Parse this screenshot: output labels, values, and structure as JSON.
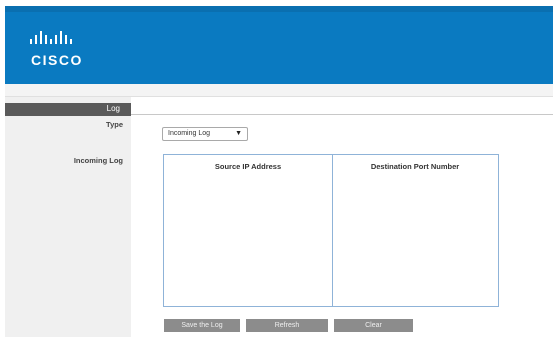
{
  "brand": {
    "logo_word": "CISCO",
    "accent_color": "#0a7ac1"
  },
  "nav": {
    "active_item": "Log"
  },
  "form": {
    "type_label": "Type",
    "type_value": "Incoming Log",
    "type_caret": "▼",
    "incoming_label": "Incoming Log"
  },
  "log_table": {
    "columns": [
      "Source IP Address",
      "Destination Port Number"
    ],
    "rows": []
  },
  "actions": {
    "save": "Save the Log",
    "refresh": "Refresh",
    "clear": "Clear"
  }
}
